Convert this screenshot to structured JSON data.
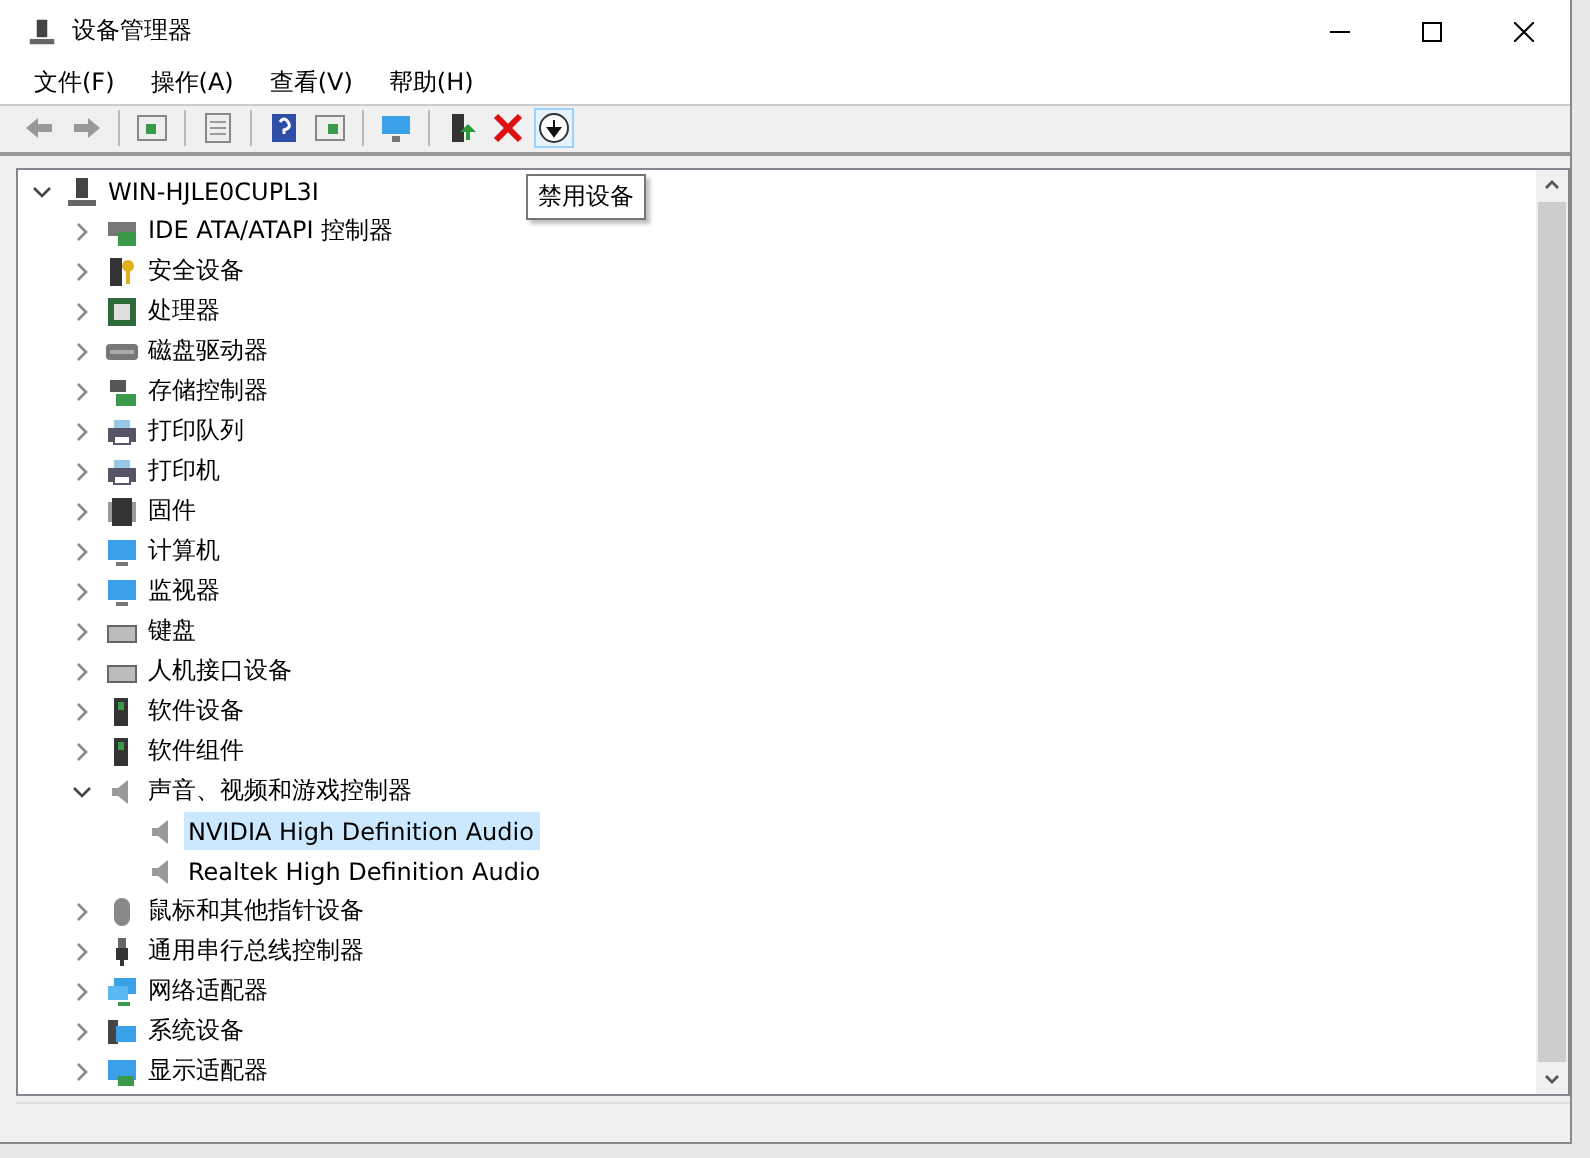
{
  "window": {
    "title": "设备管理器"
  },
  "menu": [
    {
      "label": "文件(F)"
    },
    {
      "label": "操作(A)"
    },
    {
      "label": "查看(V)"
    },
    {
      "label": "帮助(H)"
    }
  ],
  "tooltip": "禁用设备",
  "tree": {
    "label": "WIN-HJLE0CUPL3I",
    "expanded": true,
    "selected": false,
    "children": [
      {
        "label": "IDE ATA/ATAPI 控制器",
        "expanded": false,
        "selected": false
      },
      {
        "label": "安全设备",
        "expanded": false,
        "selected": false
      },
      {
        "label": "处理器",
        "expanded": false,
        "selected": false
      },
      {
        "label": "磁盘驱动器",
        "expanded": false,
        "selected": false
      },
      {
        "label": "存储控制器",
        "expanded": false,
        "selected": false
      },
      {
        "label": "打印队列",
        "expanded": false,
        "selected": false
      },
      {
        "label": "打印机",
        "expanded": false,
        "selected": false
      },
      {
        "label": "固件",
        "expanded": false,
        "selected": false
      },
      {
        "label": "计算机",
        "expanded": false,
        "selected": false
      },
      {
        "label": "监视器",
        "expanded": false,
        "selected": false
      },
      {
        "label": "键盘",
        "expanded": false,
        "selected": false
      },
      {
        "label": "人机接口设备",
        "expanded": false,
        "selected": false
      },
      {
        "label": "软件设备",
        "expanded": false,
        "selected": false
      },
      {
        "label": "软件组件",
        "expanded": false,
        "selected": false
      },
      {
        "label": "声音、视频和游戏控制器",
        "expanded": true,
        "selected": false,
        "children": [
          {
            "label": "NVIDIA High Definition Audio",
            "selected": true
          },
          {
            "label": "Realtek High Definition Audio",
            "selected": false
          }
        ]
      },
      {
        "label": "鼠标和其他指针设备",
        "expanded": false,
        "selected": false
      },
      {
        "label": "通用串行总线控制器",
        "expanded": false,
        "selected": false
      },
      {
        "label": "网络适配器",
        "expanded": false,
        "selected": false
      },
      {
        "label": "系统设备",
        "expanded": false,
        "selected": false
      },
      {
        "label": "显示适配器",
        "expanded": false,
        "selected": false
      }
    ]
  }
}
